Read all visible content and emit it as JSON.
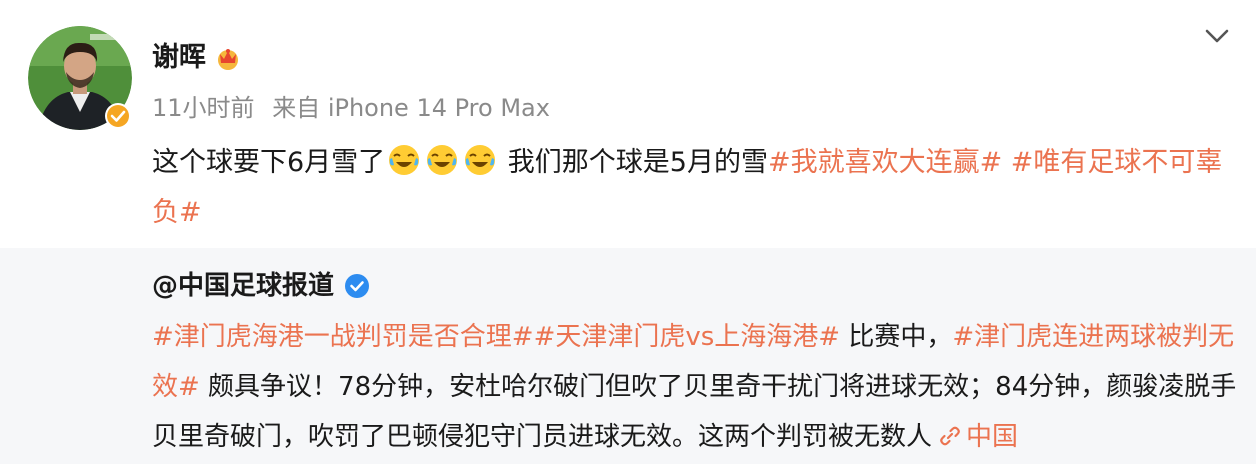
{
  "post": {
    "author": "谢晖",
    "time": "11小时前",
    "source": "来自 iPhone 14 Pro Max",
    "text_before": "这个球要下6月雪了",
    "emoji_names": [
      "laugh-cry-icon",
      "laugh-cry-icon",
      "laugh-cry-icon"
    ],
    "text_after": " 我们那个球是5月的雪",
    "hashtag_1": "#我就喜欢大连赢#",
    "hashtag_2": " #唯有足球不可辜负#"
  },
  "repost": {
    "author": "@中国足球报道",
    "hashtag_1": "#津门虎海港一战判罚是否合理#",
    "hashtag_2": "#天津津门虎vs上海海港#",
    "text_1": " 比赛中，",
    "hashtag_3": "#津门虎连进两球被判无效#",
    "text_2": " 颇具争议！78分钟，安杜哈尔破门但吹了贝里奇干扰门将进球无效；84分钟，颜骏凌脱手贝里奇破门，吹罚了巴顿侵犯守门员进球无效。这两个判罚被无数人",
    "link_text": "中国"
  },
  "colors": {
    "hashtag": "#eb7350",
    "meta": "#8a8a8a",
    "repost_bg": "#f6f7f9",
    "verified": "#f5a623"
  }
}
